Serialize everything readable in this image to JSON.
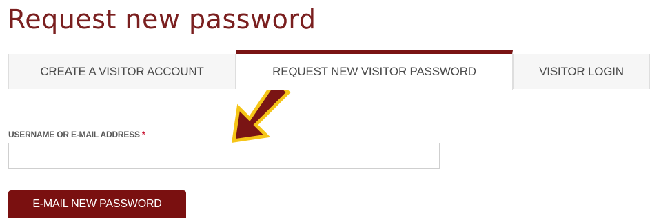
{
  "page": {
    "title": "Request new password"
  },
  "tabs": [
    {
      "label": "CREATE A VISITOR ACCOUNT",
      "active": false
    },
    {
      "label": "REQUEST NEW VISITOR PASSWORD",
      "active": true
    },
    {
      "label": "VISITOR LOGIN",
      "active": false
    }
  ],
  "form": {
    "field_label": "USERNAME OR E-MAIL ADDRESS",
    "required_marker": "*",
    "field_value": "",
    "submit_label": "E-MAIL NEW PASSWORD"
  },
  "annotation": {
    "icon": "arrow-pointing-down-left",
    "fill_color": "#7a1414",
    "outline_color": "#f5c518"
  },
  "colors": {
    "brand": "#7a1414",
    "title": "#7a1f1f",
    "required": "#c8102e"
  }
}
